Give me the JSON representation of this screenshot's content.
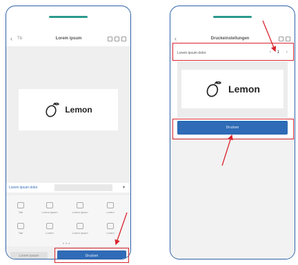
{
  "left_phone": {
    "back": "‹",
    "nav_sub": "Tb",
    "title": "Lorem ipsum",
    "label_text": "Lemon",
    "dropdown_label": "Lorem ipsum dolor",
    "tools": [
      {
        "label": "Tab"
      },
      {
        "label": "Lorem ipsum"
      },
      {
        "label": "Lorem ipsum"
      },
      {
        "label": "Lorem"
      },
      {
        "label": "Tab"
      },
      {
        "label": "Lorem"
      },
      {
        "label": "Lorem ipsum"
      },
      {
        "label": "Lorem"
      }
    ],
    "cancel_label": "Lorem ipsum",
    "print_label": "Drucken"
  },
  "right_phone": {
    "back": "‹",
    "title": "Druckeinstellungen",
    "device_label": "Lorem ipsum dolor",
    "copies": "1",
    "label_text": "Lemon",
    "print_label": "Drucken"
  },
  "colors": {
    "accent": "#2f6bb6",
    "highlight": "#d9242c",
    "frame": "#2b5fa6"
  }
}
